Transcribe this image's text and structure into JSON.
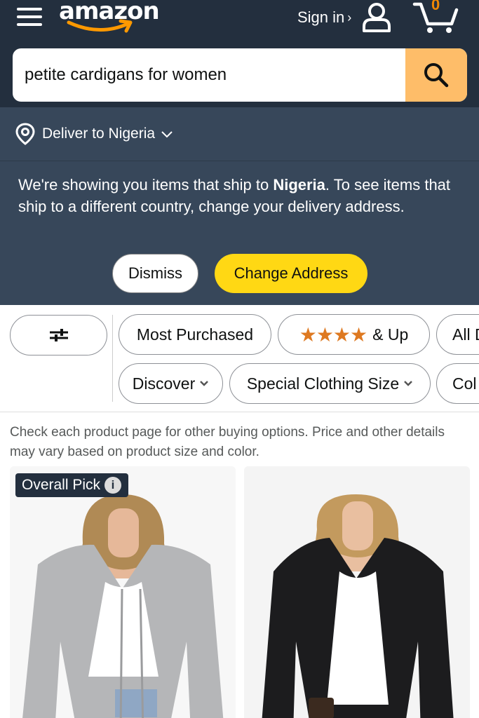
{
  "header": {
    "logo_text": "amazon",
    "signin_label": "Sign in",
    "signin_chevron": "›",
    "cart_count": "0",
    "colors": {
      "nav_bg": "#232f3e",
      "sub_bg": "#37475a",
      "search_btn": "#febd69",
      "logo_smile": "#ff9900",
      "cart_count": "#f08804"
    }
  },
  "search": {
    "value": "petite cardigans for women",
    "icon": "search-icon"
  },
  "deliver": {
    "label": "Deliver to Nigeria",
    "icon": "location-pin-icon"
  },
  "notice": {
    "text_before": "We're showing you items that ship to ",
    "country": "Nigeria",
    "text_after": ". To see items that ship to a different country, change your delivery address.",
    "dismiss_label": "Dismiss",
    "change_label": "Change Address",
    "colors": {
      "change_btn": "#ffd814"
    }
  },
  "filters": {
    "row1": [
      "Most Purchased",
      "& Up",
      "All D"
    ],
    "row2": [
      "Discover",
      "Special Clothing Size",
      "Col"
    ],
    "stars": "★★★★",
    "filter_icon": "sliders-icon",
    "colors": {
      "stars": "#de7921"
    }
  },
  "disclaimer": "Check each product page for other buying options. Price and other details may vary based on product size and color.",
  "products": [
    {
      "badge": "Overall Pick",
      "badge_icon": "info-icon",
      "info_glyph": "i",
      "cardigan_color": "#b5b6b8"
    },
    {
      "cardigan_color": "#1c1c1e"
    }
  ]
}
